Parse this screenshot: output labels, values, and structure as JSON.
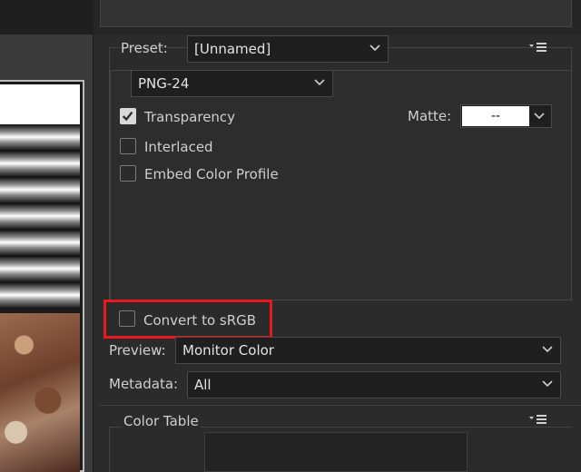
{
  "preset": {
    "label": "Preset:",
    "value": "[Unnamed]"
  },
  "format": {
    "value": "PNG-24"
  },
  "options": {
    "transparency": {
      "label": "Transparency",
      "checked": true
    },
    "interlaced": {
      "label": "Interlaced",
      "checked": false
    },
    "embed_profile": {
      "label": "Embed Color Profile",
      "checked": false
    },
    "convert_srgb": {
      "label": "Convert to sRGB",
      "checked": false
    }
  },
  "matte": {
    "label": "Matte:",
    "value": "--"
  },
  "preview": {
    "label": "Preview:",
    "value": "Monitor Color"
  },
  "metadata": {
    "label": "Metadata:",
    "value": "All"
  },
  "color_table": {
    "title": "Color Table"
  },
  "colors": {
    "highlight": "#e8181e",
    "panel_bg": "#2b2b2b",
    "field_bg": "#1f1f1f"
  },
  "icons": {
    "panel_menu": "panel-menu-icon",
    "dropdown": "chevron-down-icon",
    "check": "checkmark-icon"
  }
}
